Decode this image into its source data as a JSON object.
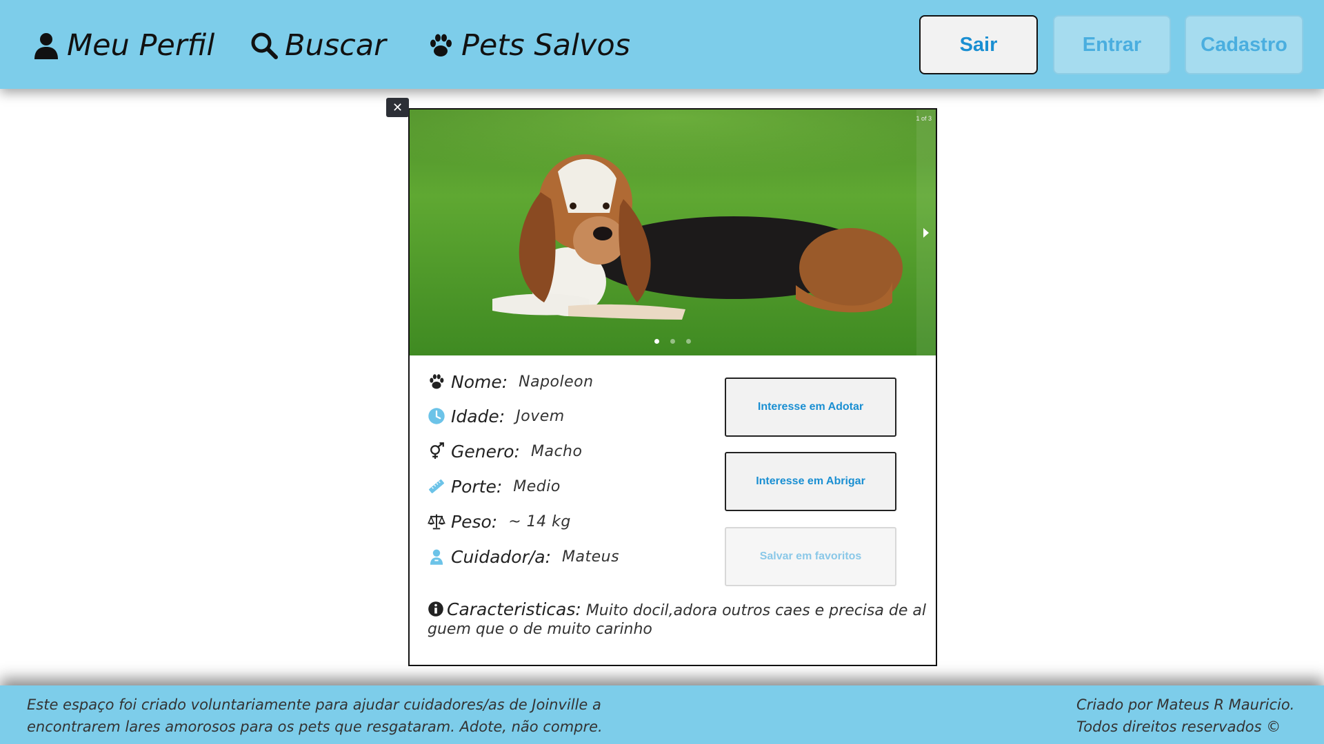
{
  "header": {
    "nav": [
      {
        "label": "Meu Perfil",
        "icon": "user-icon"
      },
      {
        "label": "Buscar",
        "icon": "search-icon"
      },
      {
        "label": "Pets Salvos",
        "icon": "paw-icon"
      }
    ],
    "buttons": {
      "sair": "Sair",
      "entrar": "Entrar",
      "cadastro": "Cadastro"
    }
  },
  "modal": {
    "close_label": "✕",
    "carousel": {
      "counter": "1 of 3",
      "slide_count": 3,
      "active_slide": 1,
      "photo": "basset-hound-on-grass"
    },
    "pet": {
      "nome": {
        "label": "Nome:",
        "value": "Napoleon",
        "icon": "paw-icon"
      },
      "idade": {
        "label": "Idade:",
        "value": "Jovem",
        "icon": "clock-icon"
      },
      "genero": {
        "label": "Genero:",
        "value": "Macho",
        "icon": "gender-icon"
      },
      "porte": {
        "label": "Porte:",
        "value": "Medio",
        "icon": "ruler-icon"
      },
      "peso": {
        "label": "Peso:",
        "value": "~ 14 kg",
        "icon": "scale-icon"
      },
      "cuidador": {
        "label": "Cuidador/a:",
        "value": "Mateus",
        "icon": "caretaker-icon"
      },
      "caracteristicas": {
        "label": "Caracteristicas:",
        "value": "Muito docil,adora outros caes e precisa de alguem que o de muito carinho",
        "icon": "info-icon"
      }
    },
    "actions": {
      "adotar": "Interesse em Adotar",
      "abrigar": "Interesse em Abrigar",
      "favoritos": "Salvar em favoritos"
    }
  },
  "footer": {
    "left_line1": "Este espaço foi criado voluntariamente para ajudar cuidadores/as de Joinville a",
    "left_line2": "encontrarem lares amorosos para os pets que resgataram. Adote, não compre.",
    "right_line1": "Criado por Mateus R Mauricio.",
    "right_line2": "Todos direitos reservados ©"
  },
  "colors": {
    "header_bg": "#7dcdea",
    "accent_blue": "#1a8fd2",
    "icon_light_blue": "#6cc3e8"
  }
}
